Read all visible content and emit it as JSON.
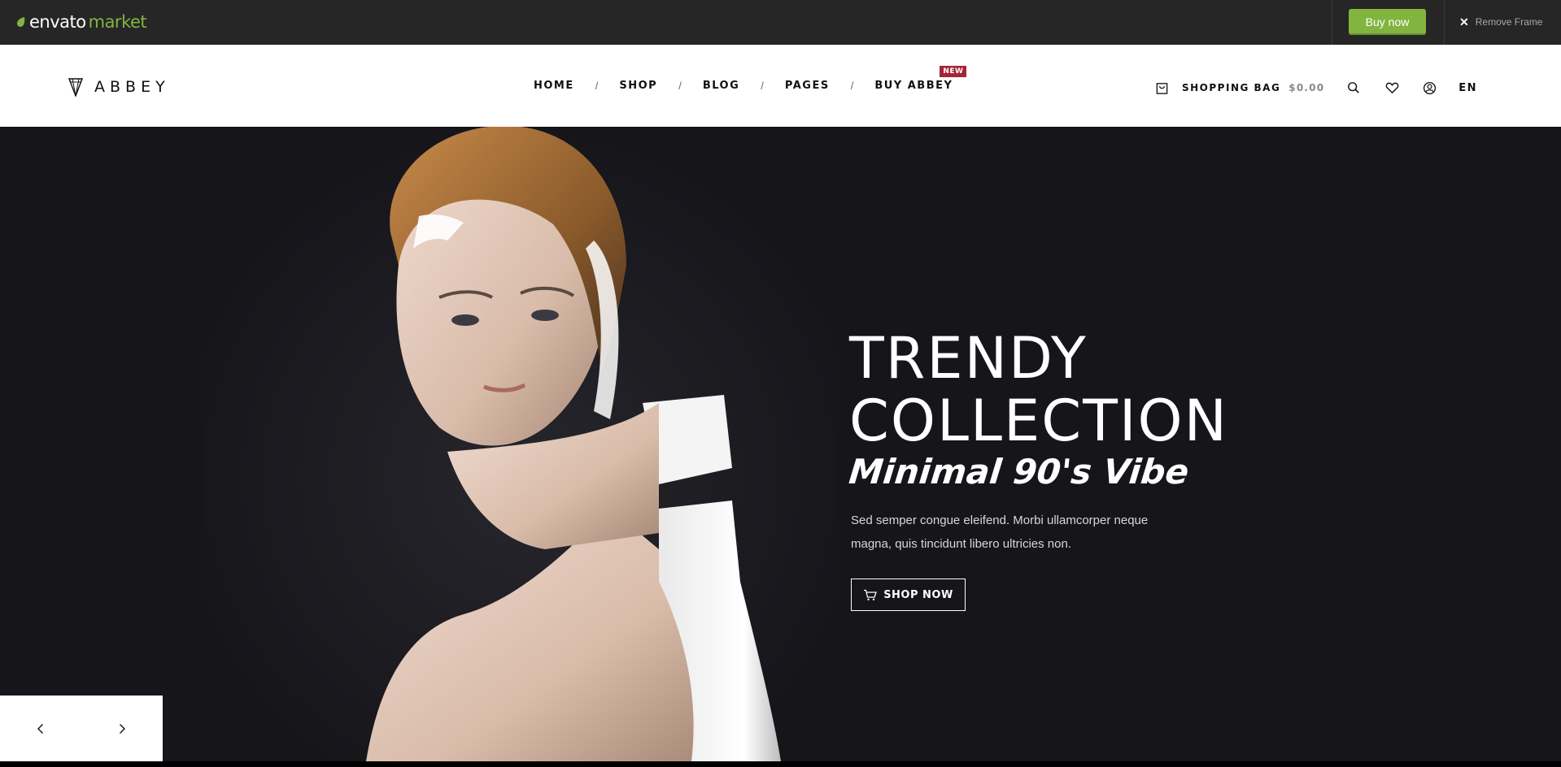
{
  "envato_bar": {
    "logo_brand": "envato",
    "logo_product": "market",
    "buy_now_label": "Buy now",
    "remove_frame_label": "Remove Frame",
    "accent_color": "#82b440"
  },
  "header": {
    "logo_text": "ABBEY",
    "nav": [
      {
        "label": "HOME"
      },
      {
        "label": "SHOP"
      },
      {
        "label": "BLOG"
      },
      {
        "label": "PAGES"
      },
      {
        "label": "BUY ABBEY",
        "badge": "NEW"
      }
    ],
    "separator": "/",
    "shopping_bag_label": "SHOPPING BAG",
    "shopping_bag_total": "$0.00",
    "language": "EN",
    "icons": [
      "shopping-bag-icon",
      "search-icon",
      "heart-icon",
      "user-icon"
    ]
  },
  "hero": {
    "title_line1": "TRENDY",
    "title_line2": "COLLECTION",
    "script_text": "Minimal 90's Vibe",
    "description": "Sed semper congue eleifend. Morbi ullamcorper neque magna, quis tincidunt libero ultricies non.",
    "cta_label": "SHOP NOW",
    "background_color": "#15151a",
    "badge_color": "#a3253a"
  },
  "slider": {
    "prev_icon": "chevron-left-icon",
    "next_icon": "chevron-right-icon"
  }
}
